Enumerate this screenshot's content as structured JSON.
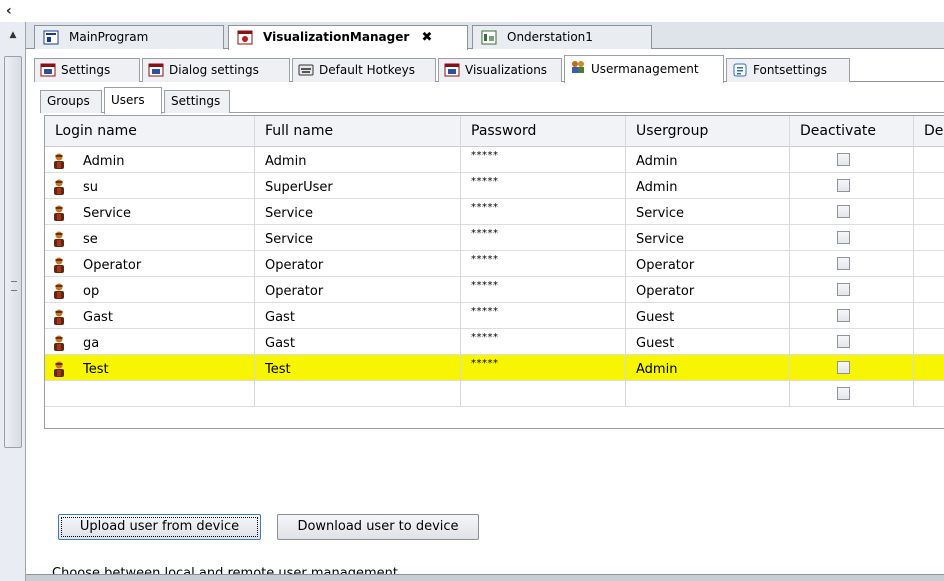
{
  "editor_tabs": [
    {
      "label": "MainProgram",
      "active": false,
      "icon": "program-icon"
    },
    {
      "label": "VisualizationManager",
      "active": true,
      "icon": "visualization-manager-icon",
      "close": "✖"
    },
    {
      "label": "Onderstation1",
      "active": false,
      "icon": "visualization-icon"
    }
  ],
  "sub_tabs": [
    {
      "label": "Settings",
      "icon": "settings-icon"
    },
    {
      "label": "Dialog settings",
      "icon": "dialog-settings-icon"
    },
    {
      "label": "Default Hotkeys",
      "icon": "keyboard-icon"
    },
    {
      "label": "Visualizations",
      "icon": "visualizations-icon"
    },
    {
      "label": "Usermanagement",
      "icon": "users-icon",
      "active": true
    },
    {
      "label": "Fontsettings",
      "icon": "font-icon"
    }
  ],
  "inner_tabs": [
    {
      "label": "Groups"
    },
    {
      "label": "Users",
      "active": true
    },
    {
      "label": "Settings"
    }
  ],
  "table": {
    "columns": [
      "Login name",
      "Full name",
      "Password",
      "Usergroup",
      "Deactivate",
      "Des"
    ],
    "rows": [
      {
        "login": "Admin",
        "full": "Admin",
        "password": "*****",
        "group": "Admin",
        "deactivated": false,
        "highlight": false
      },
      {
        "login": "su",
        "full": "SuperUser",
        "password": "*****",
        "group": "Admin",
        "deactivated": false,
        "highlight": false
      },
      {
        "login": "Service",
        "full": "Service",
        "password": "*****",
        "group": "Service",
        "deactivated": false,
        "highlight": false
      },
      {
        "login": "se",
        "full": "Service",
        "password": "*****",
        "group": "Service",
        "deactivated": false,
        "highlight": false
      },
      {
        "login": "Operator",
        "full": "Operator",
        "password": "*****",
        "group": "Operator",
        "deactivated": false,
        "highlight": false
      },
      {
        "login": "op",
        "full": "Operator",
        "password": "*****",
        "group": "Operator",
        "deactivated": false,
        "highlight": false
      },
      {
        "login": "Gast",
        "full": "Gast",
        "password": "*****",
        "group": "Guest",
        "deactivated": false,
        "highlight": false
      },
      {
        "login": "ga",
        "full": "Gast",
        "password": "*****",
        "group": "Guest",
        "deactivated": false,
        "highlight": false
      },
      {
        "login": "Test",
        "full": "Test",
        "password": "*****",
        "group": "Admin",
        "deactivated": false,
        "highlight": true
      }
    ]
  },
  "buttons": {
    "upload": "Upload user from device",
    "download": "Download user to device"
  },
  "status_text": "Choose between local and remote user management",
  "colors": {
    "highlight": "#f7f500",
    "tab_bg": "#e9ecf1",
    "border": "#8d939c"
  }
}
